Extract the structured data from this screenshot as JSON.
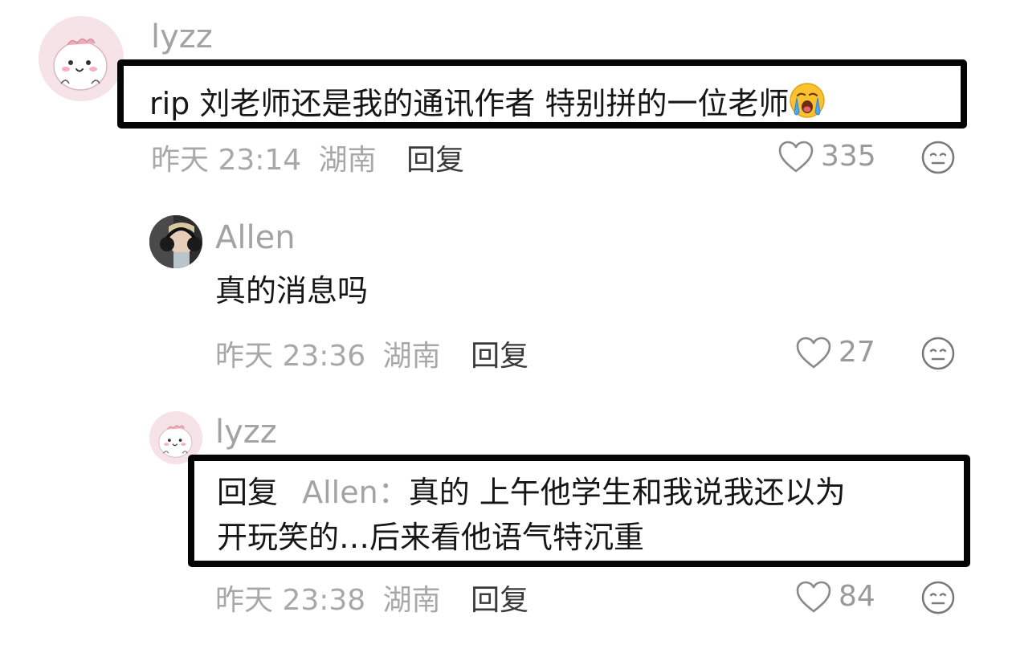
{
  "comments": [
    {
      "username": "lyzz",
      "text": "rip 刘老师还是我的通讯作者 特别拼的一位老师",
      "emoji": "loudly-crying-face",
      "time": "昨天 23:14",
      "location": "湖南",
      "reply_label": "回复",
      "likes": "335"
    },
    {
      "username": "Allen",
      "text": "真的消息吗",
      "time": "昨天 23:36",
      "location": "湖南",
      "reply_label": "回复",
      "likes": "27"
    },
    {
      "username": "lyzz",
      "reply_prefix": "回复",
      "reply_to": "Allen",
      "reply_colon": "：",
      "text_line1": "真的 上午他学生和我说我还以为",
      "text_line2": "开玩笑的…后来看他语气特沉重",
      "time": "昨天 23:38",
      "location": "湖南",
      "reply_label": "回复",
      "likes": "84"
    }
  ],
  "icons": {
    "like": "heart-outline-icon",
    "dislike": "neutral-face-icon"
  },
  "colors": {
    "muted_text": "#a8a8a8",
    "reply_text": "#3a3a3a",
    "border": "#050505",
    "avatar_pink": "#f7dfe4"
  }
}
